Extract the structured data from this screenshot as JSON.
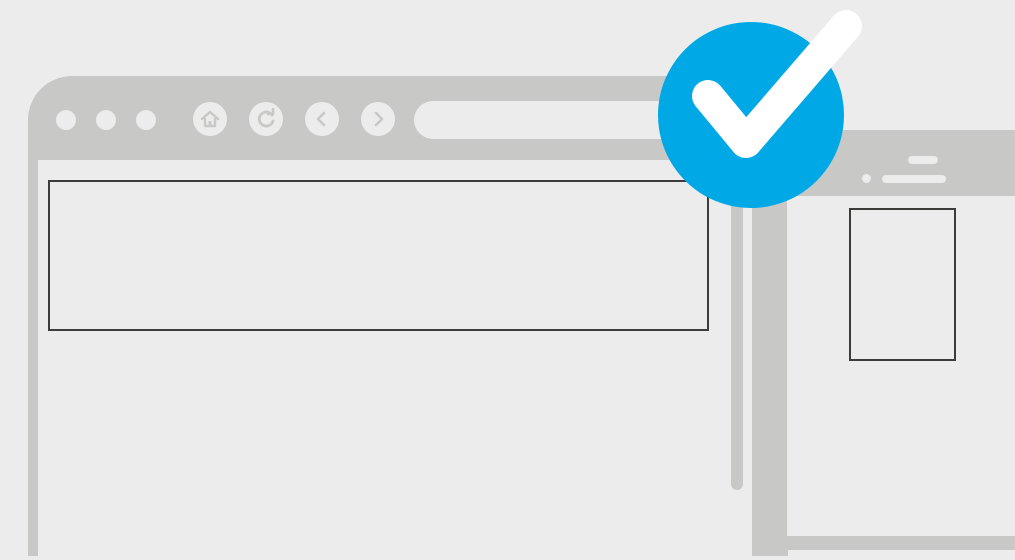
{
  "colors": {
    "background": "#ececec",
    "chrome": "#c8c8c6",
    "outline": "#3c3c3a",
    "accent": "#00a8e6",
    "checkmark": "#ffffff"
  },
  "browser": {
    "window_controls": [
      "dot",
      "dot",
      "dot"
    ],
    "nav_icons": [
      "home-icon",
      "reload-icon",
      "back-icon",
      "forward-icon"
    ]
  },
  "second_window": {
    "menu_icon": "menu-lines-icon"
  },
  "badge": {
    "icon": "checkmark-icon"
  }
}
